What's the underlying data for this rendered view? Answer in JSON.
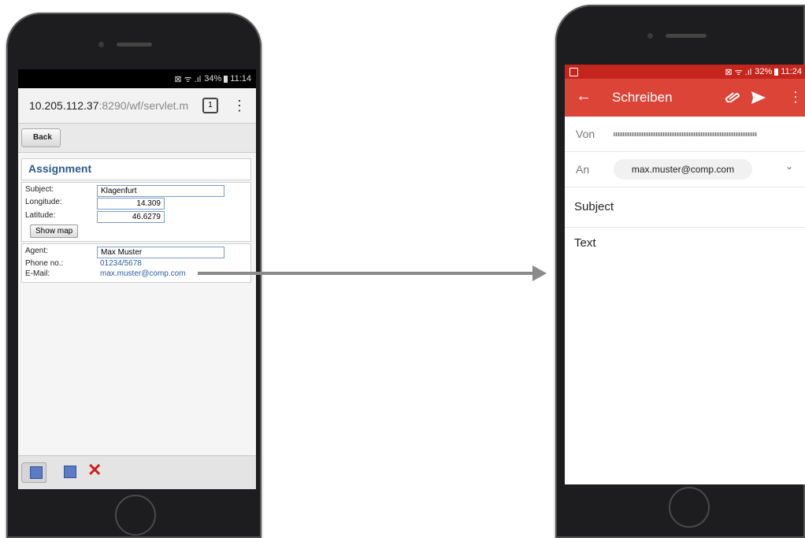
{
  "left_phone": {
    "status_bar": {
      "signal_text": "⊠ ᯤ .ıl",
      "battery": "34%",
      "time": "11:14"
    },
    "browser": {
      "url_host": "10.205.112.37",
      "url_rest": ":8290/wf/servlet.m",
      "tab_count": "1"
    },
    "back_label": "Back",
    "form": {
      "title": "Assignment",
      "subject_label": "Subject:",
      "subject_value": "Klagenfurt",
      "longitude_label": "Longitude:",
      "longitude_value": "14.309",
      "latitude_label": "Latitude:",
      "latitude_value": "46.6279",
      "show_map_label": "Show map",
      "agent_label": "Agent:",
      "agent_value": "Max Muster",
      "phone_label": "Phone no.:",
      "phone_value": "01234/5678",
      "email_label": "E-Mail:",
      "email_value": "max.muster@comp.com"
    }
  },
  "right_phone": {
    "status_bar": {
      "signal_text": "⊠ ᯤ .ıl",
      "battery": "32%",
      "time": "11:24"
    },
    "appbar_title": "Schreiben",
    "from_label": "Von",
    "to_label": "An",
    "to_value": "max.muster@comp.com",
    "subject_placeholder": "Subject",
    "body_placeholder": "Text"
  },
  "colors": {
    "gmail_red": "#db4437",
    "gmail_status": "#c4261d",
    "link_blue": "#2e5ea3",
    "title_blue": "#2b5b8a"
  }
}
